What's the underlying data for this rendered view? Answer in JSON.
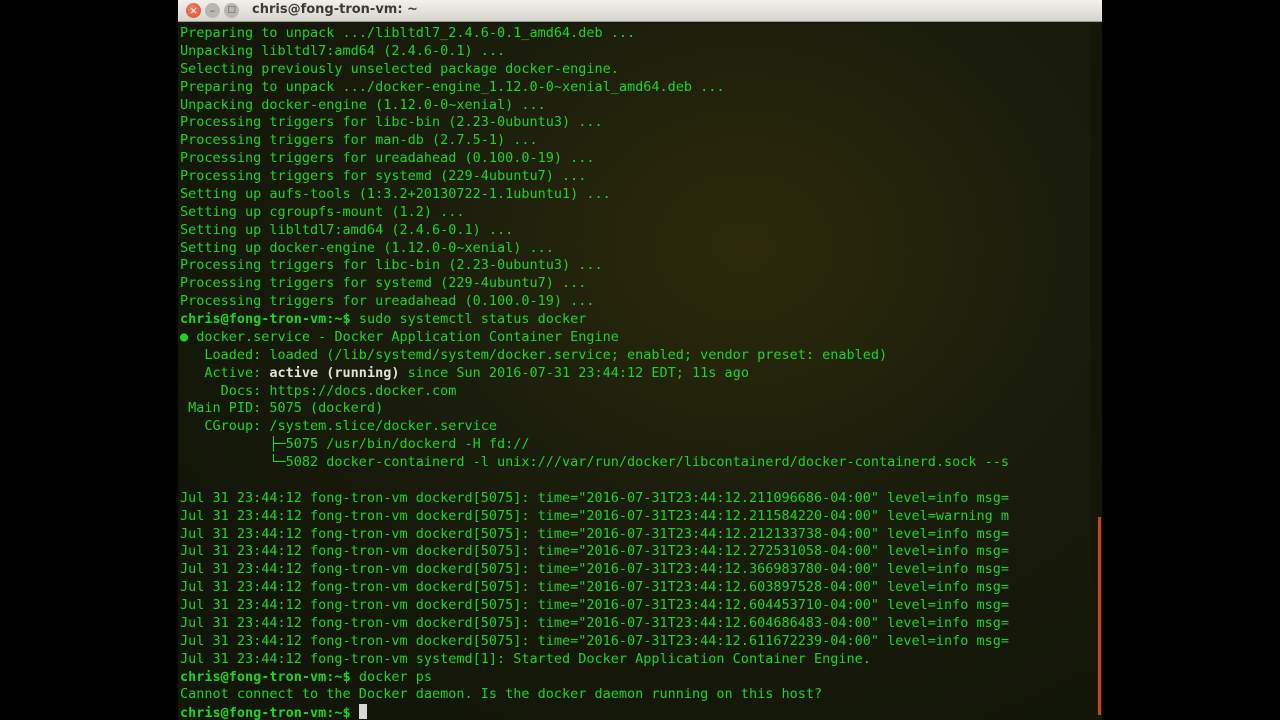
{
  "window": {
    "title": "chris@fong-tron-vm: ~"
  },
  "window_controls": {
    "close": "×",
    "minimize": "–",
    "maximize": "□"
  },
  "terminal": {
    "lines": [
      {
        "text": "Preparing to unpack .../libltdl7_2.4.6-0.1_amd64.deb ..."
      },
      {
        "text": "Unpacking libltdl7:amd64 (2.4.6-0.1) ..."
      },
      {
        "text": "Selecting previously unselected package docker-engine."
      },
      {
        "text": "Preparing to unpack .../docker-engine_1.12.0-0~xenial_amd64.deb ..."
      },
      {
        "text": "Unpacking docker-engine (1.12.0-0~xenial) ..."
      },
      {
        "text": "Processing triggers for libc-bin (2.23-0ubuntu3) ..."
      },
      {
        "text": "Processing triggers for man-db (2.7.5-1) ..."
      },
      {
        "text": "Processing triggers for ureadahead (0.100.0-19) ..."
      },
      {
        "text": "Processing triggers for systemd (229-4ubuntu7) ..."
      },
      {
        "text": "Setting up aufs-tools (1:3.2+20130722-1.1ubuntu1) ..."
      },
      {
        "text": "Setting up cgroupfs-mount (1.2) ..."
      },
      {
        "text": "Setting up libltdl7:amd64 (2.4.6-0.1) ..."
      },
      {
        "text": "Setting up docker-engine (1.12.0-0~xenial) ..."
      },
      {
        "text": "Processing triggers for libc-bin (2.23-0ubuntu3) ..."
      },
      {
        "text": "Processing triggers for systemd (229-4ubuntu7) ..."
      },
      {
        "text": "Processing triggers for ureadahead (0.100.0-19) ..."
      },
      {
        "prompt": "chris@fong-tron-vm:~$ ",
        "cmd": "sudo systemctl status docker"
      },
      {
        "dot": "●",
        "text": " docker.service - Docker Application Container Engine"
      },
      {
        "text": "   Loaded: loaded (/lib/systemd/system/docker.service; enabled; vendor preset: enabled)"
      },
      {
        "pre": "   Active: ",
        "bold": "active (running)",
        "post": " since Sun 2016-07-31 23:44:12 EDT; 11s ago"
      },
      {
        "text": "     Docs: https://docs.docker.com"
      },
      {
        "text": " Main PID: 5075 (dockerd)"
      },
      {
        "text": "   CGroup: /system.slice/docker.service"
      },
      {
        "text": "           ├─5075 /usr/bin/dockerd -H fd://"
      },
      {
        "text": "           └─5082 docker-containerd -l unix:///var/run/docker/libcontainerd/docker-containerd.sock --s"
      },
      {
        "text": ""
      },
      {
        "text": "Jul 31 23:44:12 fong-tron-vm dockerd[5075]: time=\"2016-07-31T23:44:12.211096686-04:00\" level=info msg="
      },
      {
        "text": "Jul 31 23:44:12 fong-tron-vm dockerd[5075]: time=\"2016-07-31T23:44:12.211584220-04:00\" level=warning m"
      },
      {
        "text": "Jul 31 23:44:12 fong-tron-vm dockerd[5075]: time=\"2016-07-31T23:44:12.212133738-04:00\" level=info msg="
      },
      {
        "text": "Jul 31 23:44:12 fong-tron-vm dockerd[5075]: time=\"2016-07-31T23:44:12.272531058-04:00\" level=info msg="
      },
      {
        "text": "Jul 31 23:44:12 fong-tron-vm dockerd[5075]: time=\"2016-07-31T23:44:12.366983780-04:00\" level=info msg="
      },
      {
        "text": "Jul 31 23:44:12 fong-tron-vm dockerd[5075]: time=\"2016-07-31T23:44:12.603897528-04:00\" level=info msg="
      },
      {
        "text": "Jul 31 23:44:12 fong-tron-vm dockerd[5075]: time=\"2016-07-31T23:44:12.604453710-04:00\" level=info msg="
      },
      {
        "text": "Jul 31 23:44:12 fong-tron-vm dockerd[5075]: time=\"2016-07-31T23:44:12.604686483-04:00\" level=info msg="
      },
      {
        "text": "Jul 31 23:44:12 fong-tron-vm dockerd[5075]: time=\"2016-07-31T23:44:12.611672239-04:00\" level=info msg="
      },
      {
        "text": "Jul 31 23:44:12 fong-tron-vm systemd[1]: Started Docker Application Container Engine."
      },
      {
        "prompt": "chris@fong-tron-vm:~$ ",
        "cmd": "docker ps"
      },
      {
        "text": "Cannot connect to the Docker daemon. Is the docker daemon running on this host?"
      },
      {
        "prompt": "chris@fong-tron-vm:~$ ",
        "cmd": "",
        "cursor": true
      }
    ]
  }
}
